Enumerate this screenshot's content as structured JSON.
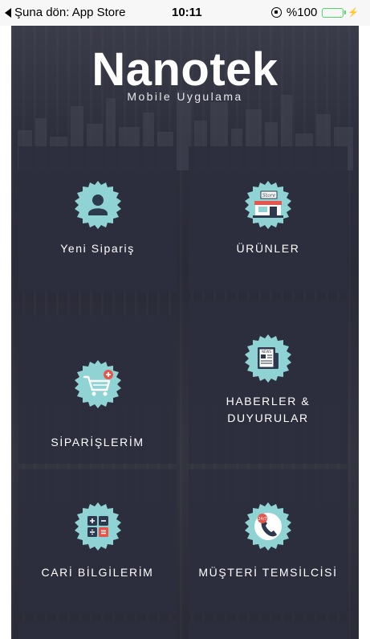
{
  "status_bar": {
    "back_label": "Şuna dön: App Store",
    "time": "10:11",
    "battery_text": "%100",
    "battery_level": 1.0,
    "battery_color": "#4cd964"
  },
  "header": {
    "title": "Nanotek",
    "subtitle": "Mobile Uygulama"
  },
  "theme": {
    "tile_bg": "#2d2e3d",
    "icon_bg": "#8fd3d4",
    "icon_dark": "#2d3a4e"
  },
  "menu": {
    "items": [
      {
        "label": "Yeni Sipariş",
        "icon": "user-icon"
      },
      {
        "label": "ÜRÜNLER",
        "icon": "store-icon"
      },
      {
        "label": "SİPARİŞLERİM",
        "icon": "cart-icon"
      },
      {
        "label": "HABERLER &",
        "label2": "DUYURULAR",
        "icon": "news-icon"
      },
      {
        "label": "CARİ BİLGİLERİM",
        "icon": "calculator-icon"
      },
      {
        "label": "MÜŞTERİ TEMSİLCİSİ",
        "icon": "phone-support-icon"
      }
    ],
    "store_sign": "Store",
    "news_sign": "NEWS",
    "support_sign": "24/7"
  }
}
